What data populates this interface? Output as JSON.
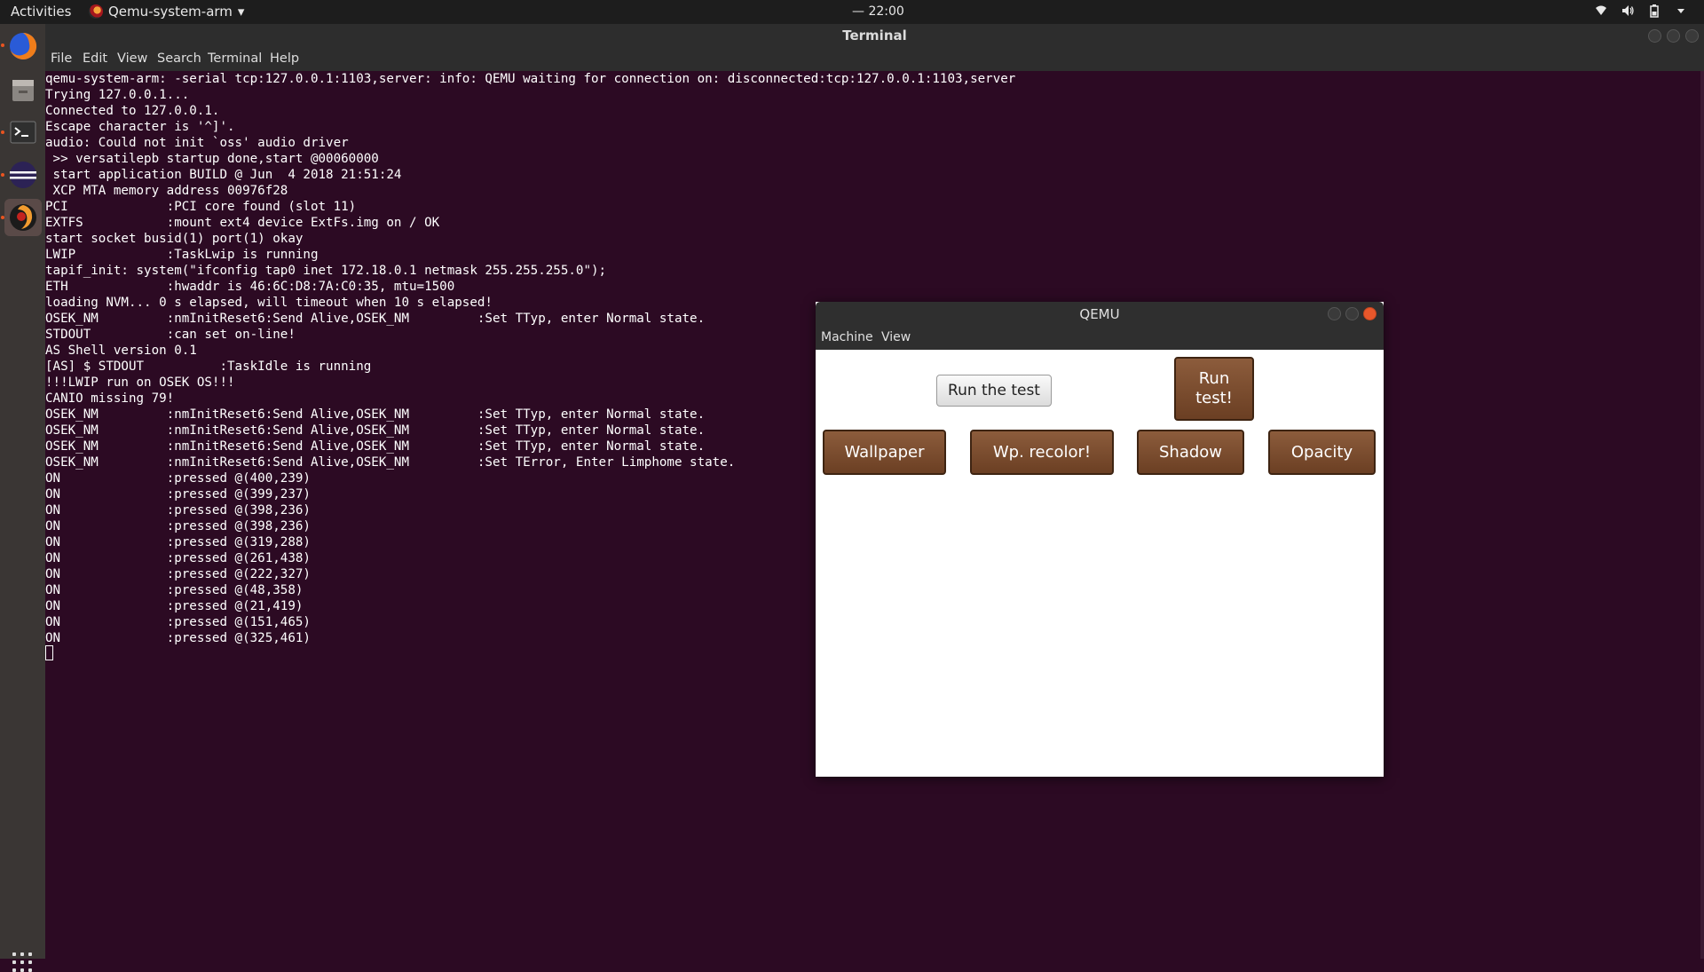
{
  "topbar": {
    "activities": "Activities",
    "app_menu": "Qemu-system-arm",
    "app_menu_arrow": "▾",
    "clock": "— 22:00",
    "tray_icons": [
      "wifi-icon",
      "volume-icon",
      "battery-icon",
      "menu-arrow-icon"
    ]
  },
  "dock": {
    "items": [
      "firefox-icon",
      "files-icon",
      "terminal-icon",
      "eclipse-icon",
      "qemu-icon"
    ]
  },
  "terminal": {
    "title": "Terminal",
    "menu": [
      "File",
      "Edit",
      "View",
      "Search",
      "Terminal",
      "Help"
    ],
    "lines": [
      "qemu-system-arm: -serial tcp:127.0.0.1:1103,server: info: QEMU waiting for connection on: disconnected:tcp:127.0.0.1:1103,server",
      "Trying 127.0.0.1...",
      "Connected to 127.0.0.1.",
      "Escape character is '^]'.",
      "audio: Could not init `oss' audio driver",
      " >> versatilepb startup done,start @00060000",
      " start application BUILD @ Jun  4 2018 21:51:24",
      " XCP MTA memory address 00976f28",
      "PCI             :PCI core found (slot 11)",
      "EXTFS           :mount ext4 device ExtFs.img on / OK",
      "start socket busid(1) port(1) okay",
      "LWIP            :TaskLwip is running",
      "tapif_init: system(\"ifconfig tap0 inet 172.18.0.1 netmask 255.255.255.0\");",
      "ETH             :hwaddr is 46:6C:D8:7A:C0:35, mtu=1500",
      "loading NVM... 0 s elapsed, will timeout when 10 s elapsed!",
      "OSEK_NM         :nmInitReset6:Send Alive,OSEK_NM         :Set TTyp, enter Normal state.",
      "STDOUT          :can set on-line!",
      "AS Shell version 0.1",
      "[AS] $ STDOUT          :TaskIdle is running",
      "!!!LWIP run on OSEK OS!!!",
      "CANIO missing 79!",
      "OSEK_NM         :nmInitReset6:Send Alive,OSEK_NM         :Set TTyp, enter Normal state.",
      "OSEK_NM         :nmInitReset6:Send Alive,OSEK_NM         :Set TTyp, enter Normal state.",
      "OSEK_NM         :nmInitReset6:Send Alive,OSEK_NM         :Set TTyp, enter Normal state.",
      "OSEK_NM         :nmInitReset6:Send Alive,OSEK_NM         :Set TError, Enter Limphome state.",
      "ON              :pressed @(400,239)",
      "ON              :pressed @(399,237)",
      "ON              :pressed @(398,236)",
      "ON              :pressed @(398,236)",
      "ON              :pressed @(319,288)",
      "ON              :pressed @(261,438)",
      "ON              :pressed @(222,327)",
      "ON              :pressed @(48,358)",
      "ON              :pressed @(21,419)",
      "ON              :pressed @(151,465)",
      "ON              :pressed @(325,461)"
    ]
  },
  "qemu": {
    "title": "QEMU",
    "menu": [
      "Machine",
      "View"
    ],
    "buttons": {
      "run_the_test": "Run the test",
      "run_test": "Run\ntest!",
      "wallpaper": "Wallpaper",
      "wp_recolor": "Wp. recolor!",
      "shadow": "Shadow",
      "opacity": "Opacity"
    }
  },
  "colors": {
    "terminal_bg": "#2c0a23",
    "button_brown": "#7a4a2c",
    "close_orange": "#e8572b"
  }
}
